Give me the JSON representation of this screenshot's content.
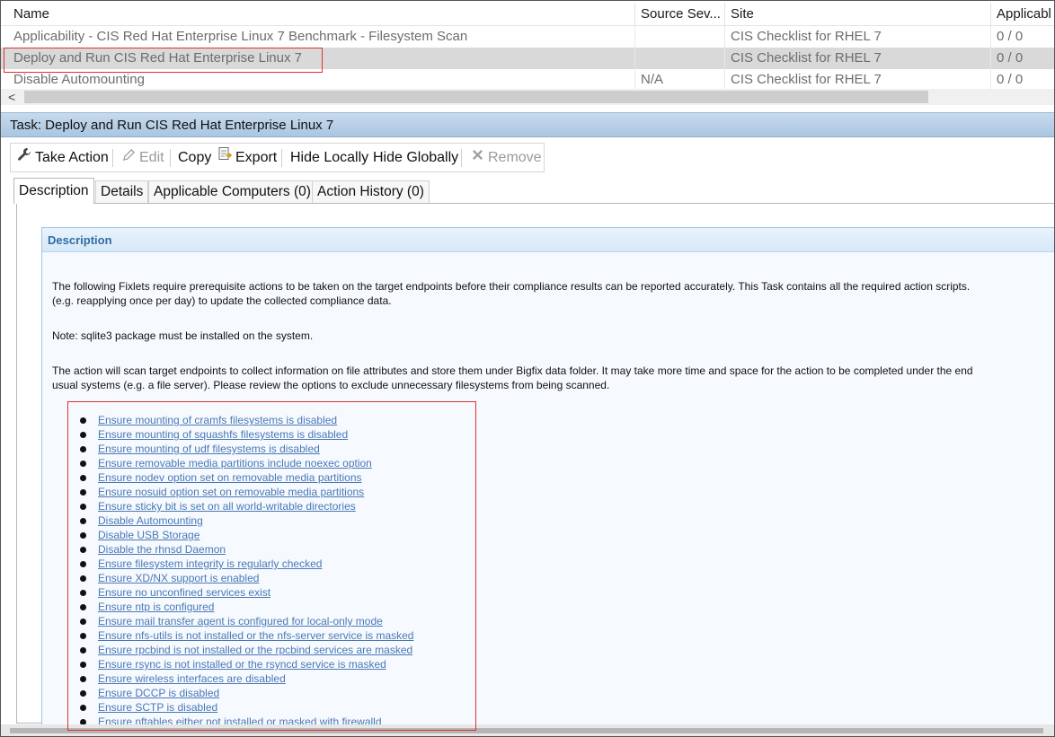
{
  "list": {
    "columns": [
      "Name",
      "Source Sev...",
      "Site",
      "Applicabl"
    ],
    "rows": [
      {
        "name": "Applicability - CIS Red Hat Enterprise Linux 7 Benchmark - Filesystem Scan",
        "severity": "",
        "site": "CIS Checklist for RHEL 7",
        "applicable": "0 / 0"
      },
      {
        "name": "Deploy and Run CIS Red Hat Enterprise Linux 7",
        "severity": "",
        "site": "CIS Checklist for RHEL 7",
        "applicable": "0 / 0"
      },
      {
        "name": "Disable Automounting",
        "severity": "N/A",
        "site": "CIS Checklist for RHEL 7",
        "applicable": "0 / 0"
      }
    ],
    "scroll_left_glyph": "<",
    "sort_glyph": "^"
  },
  "task": {
    "title": "Task: Deploy and Run CIS Red Hat Enterprise Linux 7"
  },
  "toolbar": {
    "take_action": "Take Action",
    "edit": "Edit",
    "copy": "Copy",
    "export": "Export",
    "hide_locally": "Hide Locally",
    "hide_globally": "Hide Globally",
    "remove": "Remove"
  },
  "tabs": [
    "Description",
    "Details",
    "Applicable Computers (0)",
    "Action History (0)"
  ],
  "description": {
    "heading": "Description",
    "para1_line1": "The following Fixlets require prerequisite actions to be taken on the target endpoints before their compliance results can be reported accurately. This Task contains all the required action scripts.",
    "para1_line2": "(e.g. reapplying once per day) to update the collected compliance data.",
    "note": "Note: sqlite3 package must be installed on the system.",
    "para3_line1": "The action will scan target endpoints to collect information on file attributes and store them under Bigfix data folder. It may take more time and space for the action to be completed under the end",
    "para3_line2": "usual systems (e.g. a file server). Please review the options to exclude unnecessary filesystems from being scanned.",
    "fixlets": [
      "Ensure mounting of cramfs filesystems is disabled",
      "Ensure mounting of squashfs filesystems is disabled",
      "Ensure mounting of udf filesystems is disabled",
      "Ensure removable media partitions include noexec option",
      "Ensure nodev option set on removable media partitions",
      "Ensure nosuid option set on removable media partitions",
      "Ensure sticky bit is set on all world-writable directories",
      "Disable Automounting",
      "Disable USB Storage",
      "Disable the rhnsd Daemon",
      "Ensure filesystem integrity is regularly checked",
      "Ensure XD/NX support is enabled",
      "Ensure no unconfined services exist",
      "Ensure ntp is configured",
      "Ensure mail transfer agent is configured for local-only mode",
      "Ensure nfs-utils is not installed or the nfs-server service is masked",
      "Ensure rpcbind is not installed or the rpcbind services are masked",
      "Ensure rsync is not installed or the rsyncd service is masked",
      "Ensure wireless interfaces are disabled",
      "Ensure DCCP is disabled",
      "Ensure SCTP is disabled",
      "Ensure nftables either not installed or masked with firewalld"
    ]
  },
  "colors": {
    "highlight": "#e03030",
    "link": "#4a78b4",
    "task_header": "#a9c6e2"
  }
}
